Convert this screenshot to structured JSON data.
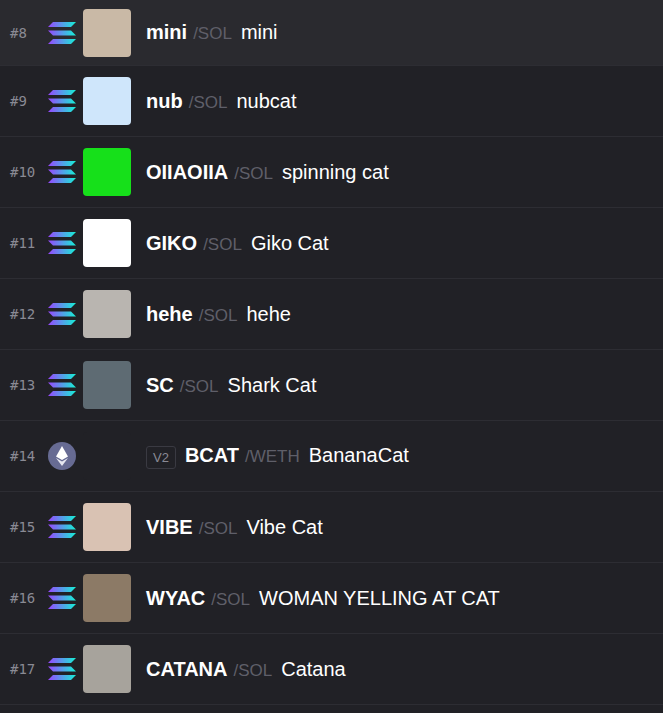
{
  "tokens": [
    {
      "rank": "#8",
      "kind": "solana",
      "symbol": "mini",
      "quote": "/SOL",
      "name": "mini",
      "selected": true
    },
    {
      "rank": "#9",
      "kind": "solana",
      "symbol": "nub",
      "quote": "/SOL",
      "name": "nubcat",
      "selected": false
    },
    {
      "rank": "#10",
      "kind": "solana",
      "symbol": "OIIAOIIA",
      "quote": "/SOL",
      "name": "spinning cat",
      "selected": false
    },
    {
      "rank": "#11",
      "kind": "solana",
      "symbol": "GIKO",
      "quote": "/SOL",
      "name": "Giko Cat",
      "selected": false
    },
    {
      "rank": "#12",
      "kind": "solana",
      "symbol": "hehe",
      "quote": "/SOL",
      "name": "hehe",
      "selected": false
    },
    {
      "rank": "#13",
      "kind": "solana",
      "symbol": "SC",
      "quote": "/SOL",
      "name": "Shark Cat",
      "selected": false
    },
    {
      "rank": "#14",
      "kind": "ethereum",
      "badge": "V2",
      "symbol": "BCAT",
      "quote": "/WETH",
      "name": "BananaCat",
      "selected": false
    },
    {
      "rank": "#15",
      "kind": "solana",
      "symbol": "VIBE",
      "quote": "/SOL",
      "name": "Vibe Cat",
      "selected": false
    },
    {
      "rank": "#16",
      "kind": "solana",
      "symbol": "WYAC",
      "quote": "/SOL",
      "name": "WOMAN YELLING AT CAT",
      "selected": false
    },
    {
      "rank": "#17",
      "kind": "solana",
      "symbol": "CATANA",
      "quote": "/SOL",
      "name": "Catana",
      "selected": false
    }
  ]
}
